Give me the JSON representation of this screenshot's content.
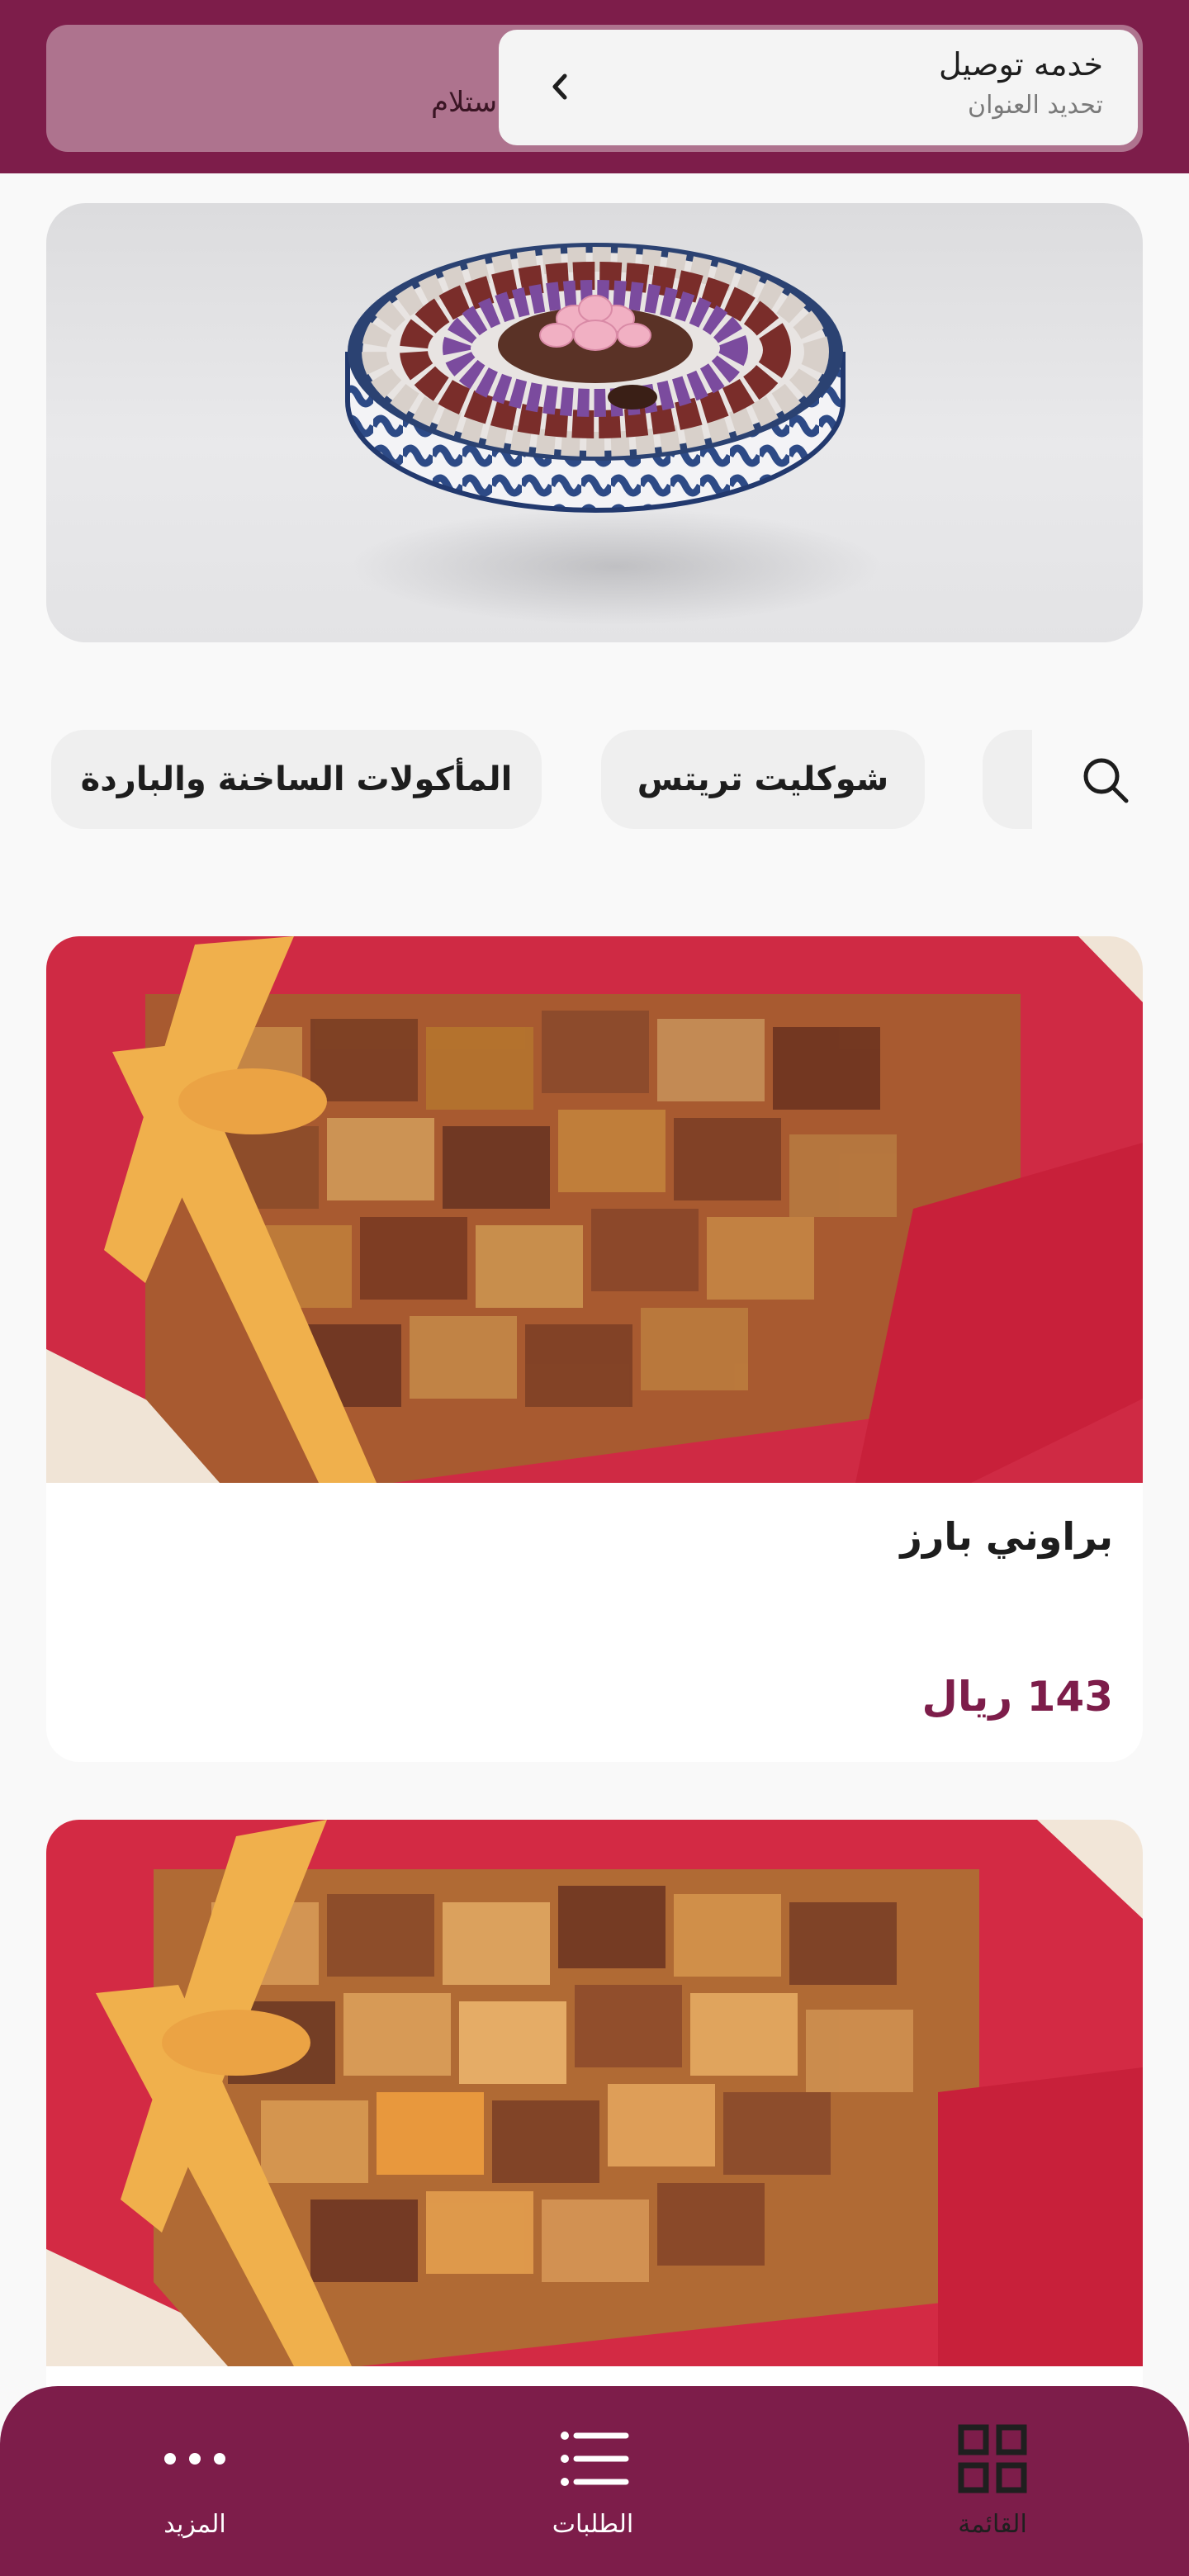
{
  "header": {
    "pickup_label": "استلام",
    "delivery_title": "خدمه توصيل",
    "delivery_subtitle": "تحديد العنوان"
  },
  "categories": {
    "chips": [
      "شوكليت تريتس",
      "المأكولات الساخنة والباردة"
    ]
  },
  "products": [
    {
      "name": "براوني بارز",
      "price": "143 ريال"
    },
    {
      "name": "",
      "price": ""
    }
  ],
  "bottom_nav": {
    "items": [
      {
        "label": "القائمة",
        "icon": "grid-icon",
        "active": true
      },
      {
        "label": "الطلبات",
        "icon": "list-icon",
        "active": false
      },
      {
        "label": "المزيد",
        "icon": "more-dots-icon",
        "active": false
      }
    ]
  },
  "colors": {
    "brand": "#7d1d4a",
    "nav_active_icon": "#1f1f1f",
    "nav_inactive": "#ffffff"
  }
}
